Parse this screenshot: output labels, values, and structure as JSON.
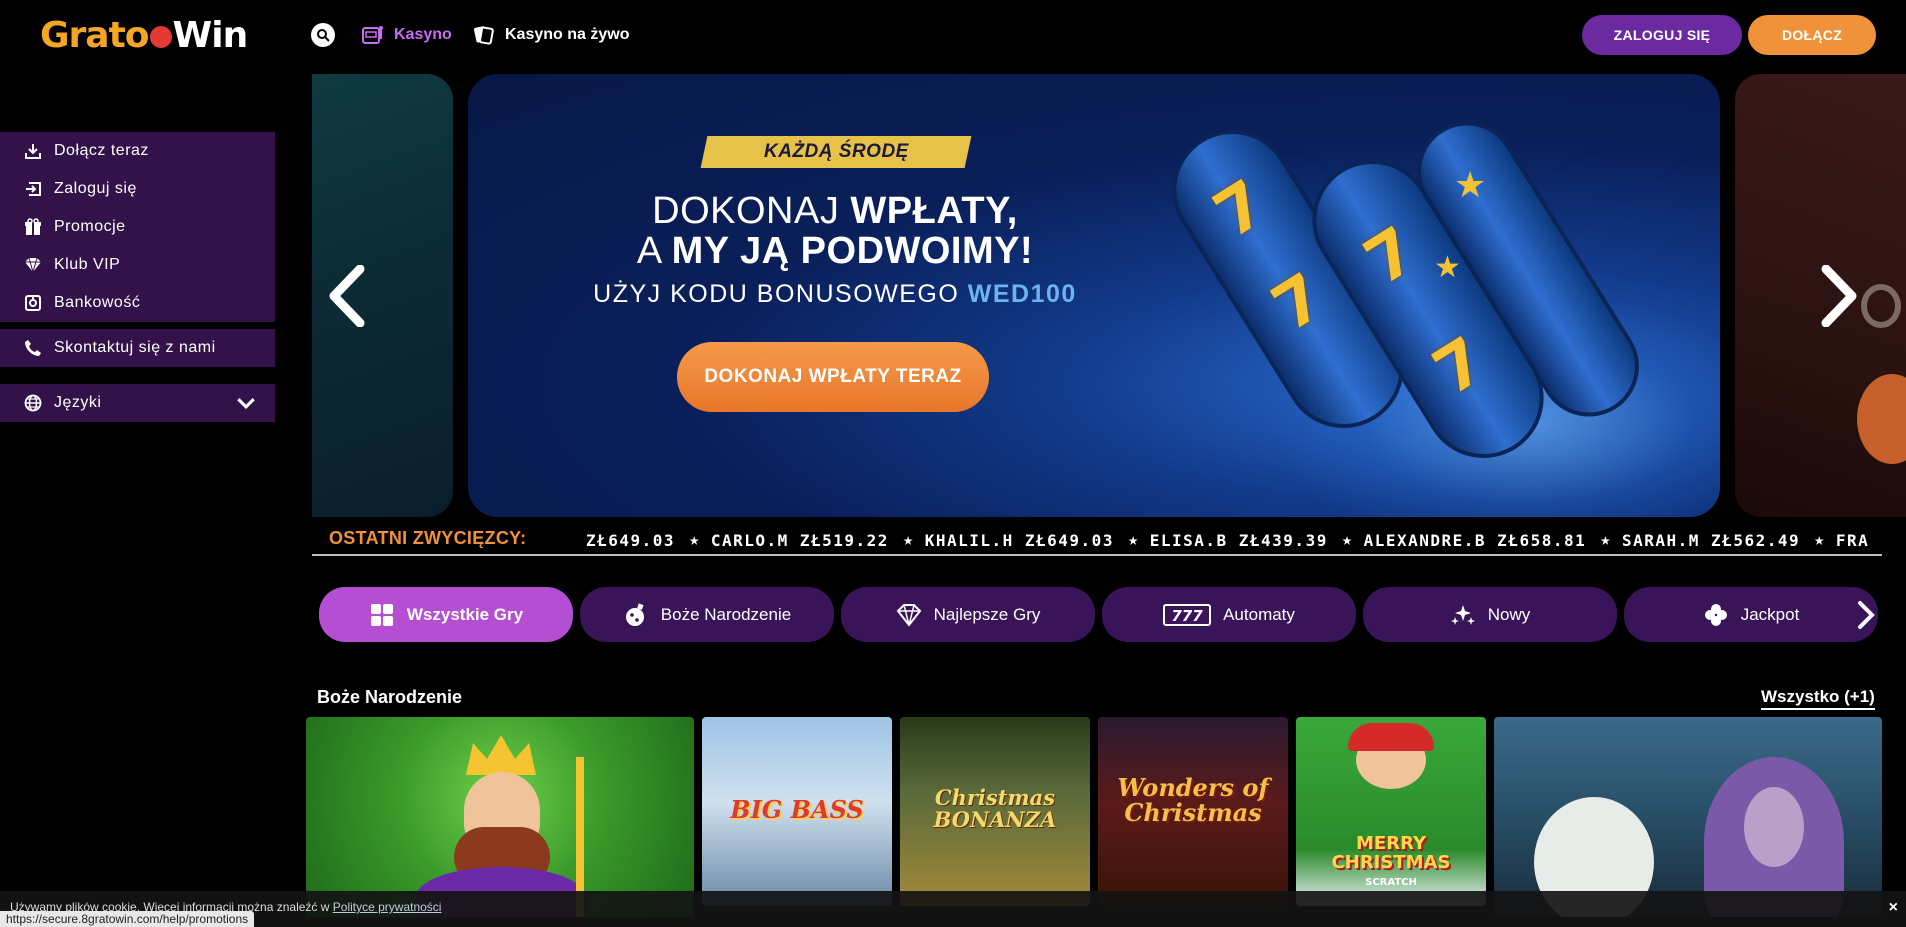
{
  "header": {
    "logo_part1": "Grato",
    "logo_part2": "Win",
    "nav": [
      {
        "label": "Kasyno",
        "icon": "slot-machine-icon",
        "active": true
      },
      {
        "label": "Kasyno na żywo",
        "icon": "cards-icon",
        "active": false
      }
    ],
    "login_label": "ZALOGUJ SIĘ",
    "join_label": "DOŁĄCZ"
  },
  "sidebar": {
    "items": [
      {
        "label": "Dołącz teraz",
        "icon": "download-icon"
      },
      {
        "label": "Zaloguj się",
        "icon": "login-icon"
      },
      {
        "label": "Promocje",
        "icon": "gift-icon"
      },
      {
        "label": "Klub VIP",
        "icon": "diamond-icon"
      },
      {
        "label": "Bankowość",
        "icon": "bank-icon"
      }
    ],
    "contact": {
      "label": "Skontaktuj się z nami",
      "icon": "phone-icon"
    },
    "languages": {
      "label": "Języki",
      "icon": "globe-icon"
    }
  },
  "hero": {
    "badge": "KAŻDĄ ŚRODĘ",
    "line1_normal": "DOKONAJ ",
    "line1_bold": "WPŁATY,",
    "line2_normal": "A ",
    "line2_bold": "MY JĄ PODWOIMY!",
    "line3_normal": "UŻYJ KODU BONUSOWEGO ",
    "line3_code": "WED100",
    "cta": "DOKONAJ WPŁATY TERAZ"
  },
  "winners": {
    "label": "OSTATNI ZWYCIĘZCY:",
    "entries": [
      "ZŁ649.03",
      "CARLO.M ZŁ519.22",
      "KHALIL.H ZŁ649.03",
      "ELISA.B ZŁ439.39",
      "ALEXANDRE.B ZŁ658.81",
      "SARAH.M ZŁ562.49",
      "FRA"
    ]
  },
  "tabs": [
    {
      "label": "Wszystkie Gry",
      "icon": "grid-icon",
      "active": true
    },
    {
      "label": "Boże Narodzenie",
      "icon": "christmas-ornament-icon",
      "active": false
    },
    {
      "label": "Najlepsze Gry",
      "icon": "diamond-icon",
      "active": false
    },
    {
      "label": "Automaty",
      "icon": "slots-777-icon",
      "active": false
    },
    {
      "label": "Nowy",
      "icon": "sparkles-icon",
      "active": false
    },
    {
      "label": "Jackpot",
      "icon": "clover-icon",
      "active": false
    }
  ],
  "section": {
    "title": "Boże Narodzenie",
    "view_all": "Wszystko (+1)"
  },
  "games": [
    {
      "title": "",
      "name": "king-game"
    },
    {
      "title": "BIG BASS",
      "name": "big-bass-game"
    },
    {
      "title": "Christmas BONANZA",
      "name": "christmas-bonanza-game"
    },
    {
      "title": "Wonders of Christmas",
      "name": "wonders-of-christmas-game"
    },
    {
      "title": "MERRY CHRISTMAS",
      "subtitle": "SCRATCH",
      "name": "merry-christmas-game"
    },
    {
      "title": "",
      "name": "ice-queen-game"
    }
  ],
  "cookie": {
    "text_prefix": "Używamy plików cookie. Więcej informacji można znaleźć w ",
    "link": "Polityce prywatności",
    "close": "×"
  },
  "status_url": "https://secure.8gratowin.com/help/promotions",
  "colors": {
    "accent_purple": "#6b2aa0",
    "accent_orange": "#f0923a",
    "sidebar_bg": "#33124a",
    "tab_bg": "#3a1458",
    "tab_active": "#b44fd4"
  }
}
